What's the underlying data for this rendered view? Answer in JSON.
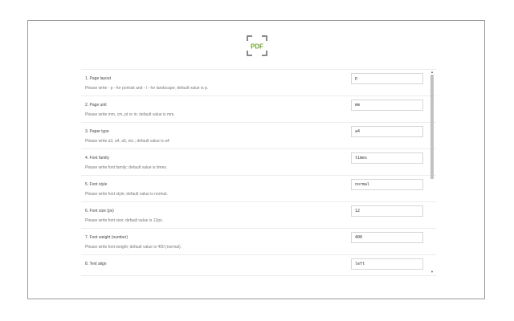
{
  "logo": {
    "text": "PDF",
    "colors": {
      "accent": "#6fa832",
      "frame": "#8a8a8a"
    }
  },
  "settings": [
    {
      "title": "1. Page layout",
      "hint": "Please write - p - for portrait and - l - for landscape; default value is p.",
      "value": "p"
    },
    {
      "title": "2. Page unit",
      "hint": "Please write mm, cm, pt or in; default value is mm.",
      "value": "mm"
    },
    {
      "title": "3. Paper type",
      "hint": "Please write a3, a4, a5, etc.; default value is a4",
      "value": "a4"
    },
    {
      "title": "4. Font family",
      "hint": "Please write font family; default value is times.",
      "value": "times"
    },
    {
      "title": "5. Font style",
      "hint": "Please write font style; default value is normal.",
      "value": "normal"
    },
    {
      "title": "6. Font size (px)",
      "hint": "Please write font size; default value is 12px.",
      "value": "12"
    },
    {
      "title": "7. Font weight (number)",
      "hint": "Please write font weight; default value is 400 (normal).",
      "value": "400"
    },
    {
      "title": "8. Text align",
      "hint": "",
      "value": "left"
    }
  ],
  "scrollbar": {
    "up_arrow": "▲",
    "down_arrow": "▼"
  }
}
